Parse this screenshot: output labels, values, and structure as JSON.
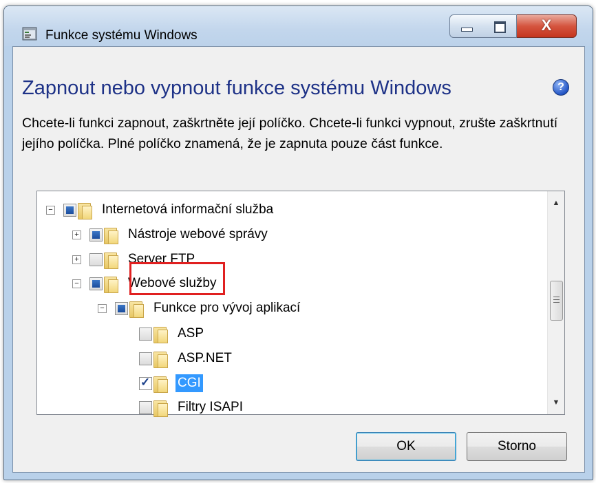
{
  "window": {
    "title": "Funkce systému Windows",
    "close_glyph": "X"
  },
  "heading": "Zapnout nebo vypnout funkce systému Windows",
  "help_glyph": "?",
  "description": "Chcete-li funkci zapnout, zaškrtněte její políčko. Chcete-li funkci vypnout, zrušte zaškrtnutí jejího políčka. Plné políčko znamená, že je zapnuta pouze část funkce.",
  "tree": {
    "items": [
      {
        "label": "Internetová informační služba",
        "expander": "−",
        "check": "partial"
      },
      {
        "label": "Nástroje webové správy",
        "expander": "+",
        "check": "partial"
      },
      {
        "label": "Server FTP",
        "expander": "+",
        "check": "unchecked"
      },
      {
        "label": "Webové služby",
        "expander": "−",
        "check": "partial"
      },
      {
        "label": "Funkce pro vývoj aplikací",
        "expander": "−",
        "check": "partial"
      },
      {
        "label": "ASP",
        "expander": "",
        "check": "unchecked"
      },
      {
        "label": "ASP.NET",
        "expander": "",
        "check": "unchecked"
      },
      {
        "label": "CGI",
        "expander": "",
        "check": "checked",
        "selected": true
      },
      {
        "label": "Filtry ISAPI",
        "expander": "",
        "check": "unchecked"
      }
    ]
  },
  "check_glyph": "✓",
  "scroll_up": "▲",
  "scroll_down": "▼",
  "buttons": {
    "ok": "OK",
    "cancel": "Storno"
  }
}
